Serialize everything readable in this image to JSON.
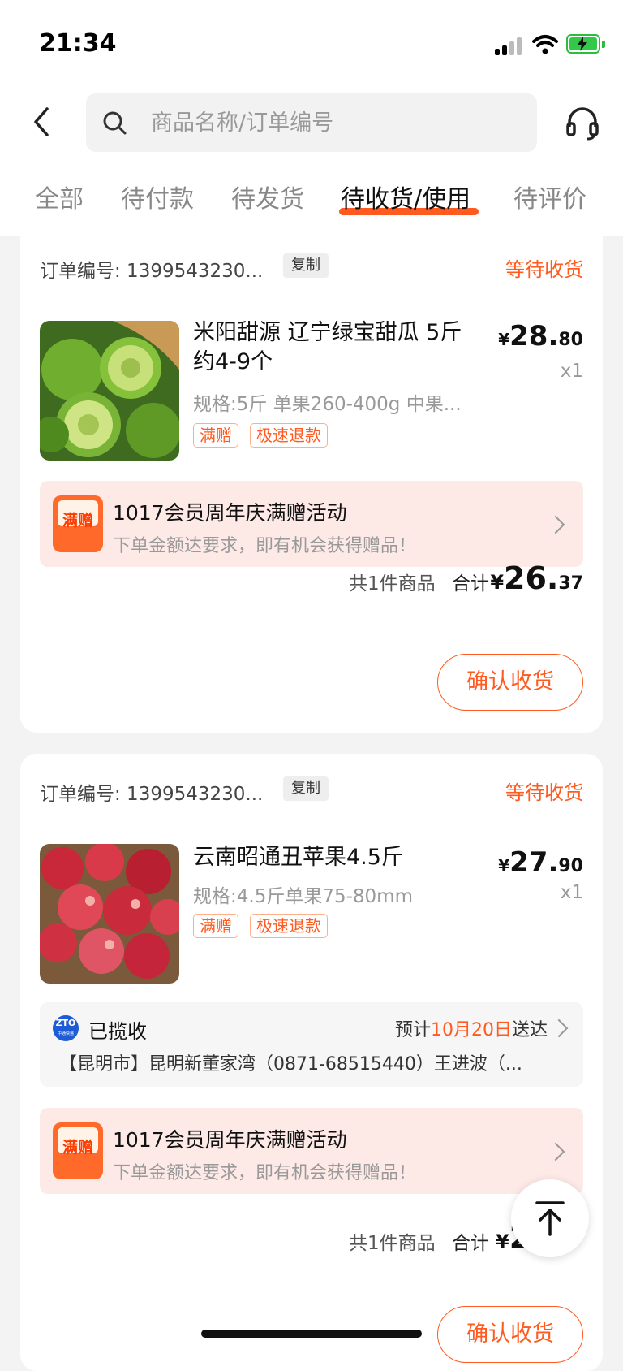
{
  "status_bar": {
    "time": "21:34"
  },
  "header": {
    "search_placeholder": "商品名称/订单编号"
  },
  "tabs": [
    {
      "label": "全部",
      "active": false
    },
    {
      "label": "待付款",
      "active": false
    },
    {
      "label": "待发货",
      "active": false
    },
    {
      "label": "待收货/使用",
      "active": true
    },
    {
      "label": "待评价",
      "active": false
    }
  ],
  "accent_color": "#ff5a1f",
  "orders": [
    {
      "order_no": "订单编号: 1399543230...",
      "copy_label": "复制",
      "status": "等待收货",
      "product": {
        "title": "米阳甜源 辽宁绿宝甜瓜 5斤约4-9个",
        "spec": "规格:5斤 单果260-400g 中果...",
        "tags": [
          "满赠",
          "极速退款"
        ],
        "price_yen": "¥",
        "price_int": "28.",
        "price_dec": "80",
        "qty": "x1",
        "image_icon": "green-melon-image"
      },
      "promo": {
        "badge": "满赠",
        "title": "1017会员周年庆满赠活动",
        "subtitle": "下单金额达要求，即有机会获得赠品！"
      },
      "summary": {
        "count": "共1件商品",
        "total_label": "合计",
        "yen": "¥",
        "int": "26.",
        "dec": "37"
      },
      "confirm_label": "确认收货"
    },
    {
      "order_no": "订单编号: 1399543230...",
      "copy_label": "复制",
      "status": "等待收货",
      "product": {
        "title": "云南昭通丑苹果4.5斤",
        "spec": "规格:4.5斤单果75-80mm",
        "tags": [
          "满赠",
          "极速退款"
        ],
        "price_yen": "¥",
        "price_int": "27.",
        "price_dec": "90",
        "qty": "x1",
        "image_icon": "red-apples-image"
      },
      "logistics": {
        "carrier_icon": "zto-express-logo",
        "carrier_logo_text": "ZTO",
        "carrier_logo_sub": "中通快递",
        "status": "已揽收",
        "eta_prefix": "预计",
        "eta_date": "10月20日",
        "eta_suffix": "送达",
        "detail": "【昆明市】昆明新董家湾（0871-68515440）王进波（..."
      },
      "promo": {
        "badge": "满赠",
        "title": "1017会员周年庆满赠活动",
        "subtitle": "下单金额达要求，即有机会获得赠品！"
      },
      "summary": {
        "count": "共1件商品",
        "total_label": "合计",
        "yen": "¥",
        "int": "2"
      },
      "confirm_label": "确认收货"
    }
  ]
}
